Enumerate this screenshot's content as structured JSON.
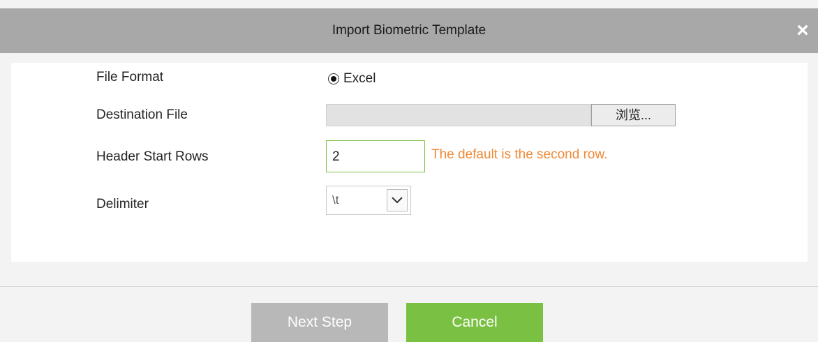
{
  "dialog": {
    "title": "Import Biometric Template",
    "close_label": "×"
  },
  "form": {
    "file_format": {
      "label": "File Format",
      "option_label": "Excel",
      "selected": true
    },
    "destination_file": {
      "label": "Destination File",
      "value": "",
      "browse_label": "浏览..."
    },
    "header_start_rows": {
      "label": "Header Start Rows",
      "value": "2",
      "hint": "The default is the second row."
    },
    "delimiter": {
      "label": "Delimiter",
      "value": "\\t"
    }
  },
  "footer": {
    "next_label": "Next Step",
    "cancel_label": "Cancel"
  },
  "colors": {
    "titlebar": "#a8a8a8",
    "accent_green": "#7ac143",
    "hint_orange": "#ef8a36",
    "disabled_gray": "#b8b8b8"
  },
  "icons": [
    "close-icon",
    "radio-checked-icon",
    "chevron-down-icon"
  ]
}
